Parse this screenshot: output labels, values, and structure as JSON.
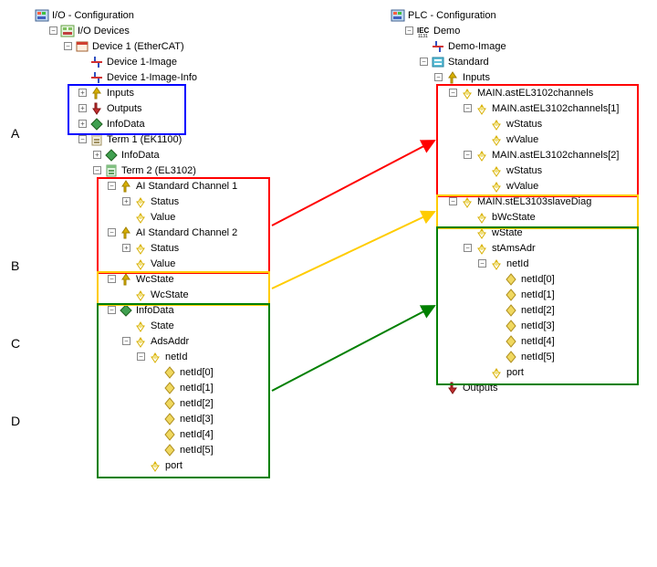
{
  "left": {
    "title": "I/O - Configuration",
    "devices": "I/O Devices",
    "device1": "Device 1 (EtherCAT)",
    "dev1image": "Device 1-Image",
    "dev1imageinfo": "Device 1-Image-Info",
    "inputs": "Inputs",
    "outputs": "Outputs",
    "infodata": "InfoData",
    "term1": "Term 1 (EK1100)",
    "term2": "Term 2 (EL3102)",
    "aich1": "AI Standard Channel 1",
    "aich2": "AI Standard Channel 2",
    "status": "Status",
    "value": "Value",
    "wcstate_group": "WcState",
    "wcstate": "WcState",
    "infodata2": "InfoData",
    "state": "State",
    "adsaddr": "AdsAddr",
    "netid": "netId",
    "netid0": "netId[0]",
    "netid1": "netId[1]",
    "netid2": "netId[2]",
    "netid3": "netId[3]",
    "netid4": "netId[4]",
    "netid5": "netId[5]",
    "port": "port"
  },
  "right": {
    "title": "PLC - Configuration",
    "demo": "Demo",
    "demoimage": "Demo-Image",
    "standard": "Standard",
    "inputs": "Inputs",
    "mainchannels": "MAIN.astEL3102channels",
    "ch1": "MAIN.astEL3102channels[1]",
    "ch2": "MAIN.astEL3102channels[2]",
    "wstatus": "wStatus",
    "wvalue": "wValue",
    "slavediag": "MAIN.stEL3103slaveDiag",
    "bwcstate": "bWcState",
    "wstate": "wState",
    "stamsadr": "stAmsAdr",
    "netid": "netId",
    "netid0": "netId[0]",
    "netid1": "netId[1]",
    "netid2": "netId[2]",
    "netid3": "netId[3]",
    "netid4": "netId[4]",
    "netid5": "netId[5]",
    "port": "port",
    "outputs": "Outputs"
  },
  "letters": {
    "a": "A",
    "b": "B",
    "c": "C",
    "d": "D"
  },
  "boxes": {
    "blue": {
      "color": "#0000ff"
    },
    "red_l": {
      "color": "#ff0000"
    },
    "yel_l": {
      "color": "#ffcc00"
    },
    "grn_l": {
      "color": "#008000"
    },
    "red_r": {
      "color": "#ff0000"
    },
    "yel_r": {
      "color": "#ffcc00"
    },
    "grn_r": {
      "color": "#008000"
    }
  }
}
